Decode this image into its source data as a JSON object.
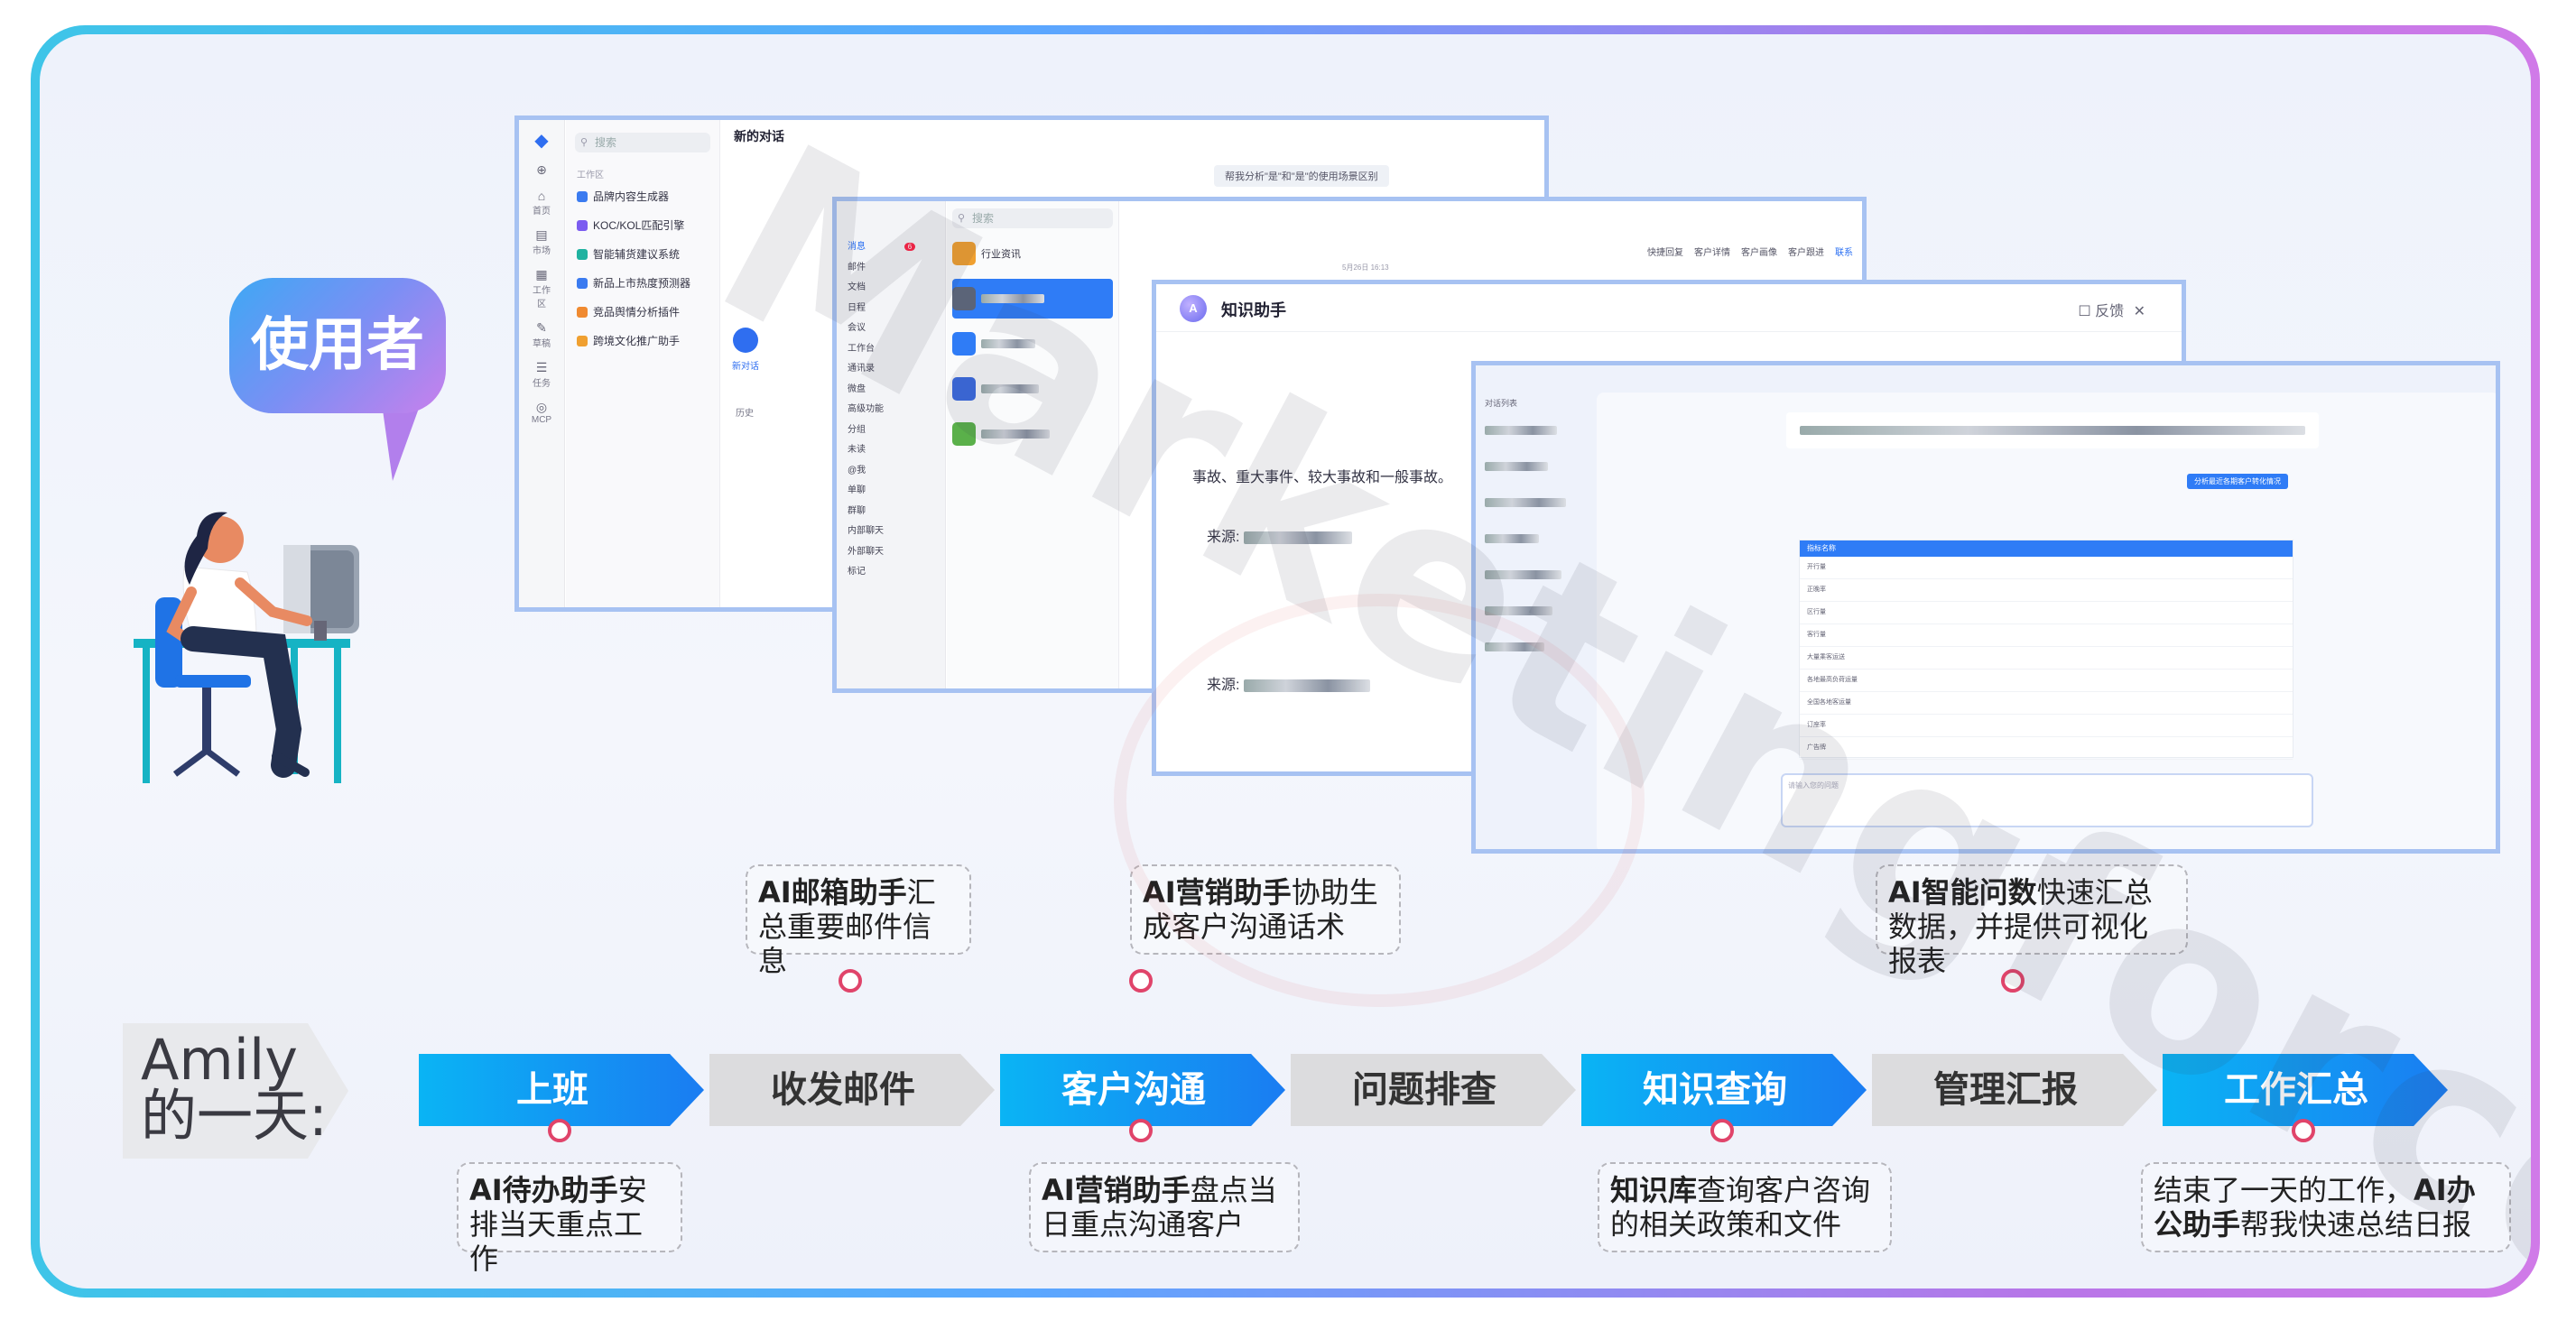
{
  "bubble_label": "使用者",
  "timeline": {
    "title_line1": "Amily",
    "title_line2": "的一天:",
    "steps": [
      {
        "label": "上班",
        "active": true
      },
      {
        "label": "收发邮件",
        "active": false
      },
      {
        "label": "客户沟通",
        "active": true
      },
      {
        "label": "问题排查",
        "active": false
      },
      {
        "label": "知识查询",
        "active": true
      },
      {
        "label": "管理汇报",
        "active": false
      },
      {
        "label": "工作汇总",
        "active": true
      }
    ]
  },
  "notes": {
    "top_mail": {
      "bold": "AI邮箱助手",
      "rest": "汇总重要邮件信息"
    },
    "top_marketing": {
      "bold": "AI营销助手",
      "rest": "协助生成客户沟通话术"
    },
    "top_data": {
      "bold": "AI智能问数",
      "rest": "快速汇总数据，并提供可视化报表"
    },
    "bottom_todo": {
      "bold": "AI待办助手",
      "rest": "安排当天重点工作"
    },
    "bottom_marketing": {
      "bold": "AI营销助手",
      "rest": "盘点当日重点沟通客户"
    },
    "bottom_knowledge": {
      "bold": "知识库",
      "rest": "查询客户咨询的相关政策和文件"
    },
    "bottom_summary": {
      "lead": "结束了一天的工作，",
      "bold": "AI办公助手",
      "rest": "帮我快速总结日报"
    }
  },
  "window1": {
    "search_placeholder": "搜索",
    "title": "新的对话",
    "section": "工作区",
    "items": [
      "品牌内容生成器",
      "KOC/KOL匹配引擎",
      "智能辅货建议系统",
      "新品上市热度预测器",
      "竞品舆情分析插件",
      "跨境文化推广助手"
    ],
    "prompt_pill": "帮我分析\"是\"和\"是\"的使用场景区别",
    "side_labels": [
      "首页",
      "市场",
      "工作区",
      "草稿",
      "任务",
      "MCP"
    ],
    "new_chat": "新对话",
    "history": "历史"
  },
  "window2": {
    "search_placeholder": "搜索",
    "nav": [
      "消息",
      "邮件",
      "文档",
      "日程",
      "会议",
      "工作台",
      "通讯录",
      "微盘",
      "高级功能",
      "分组",
      "未读",
      "@我",
      "单聊",
      "群聊",
      "内部聊天",
      "外部聊天",
      "标记"
    ],
    "unread_badge": "6",
    "industry": "行业资讯",
    "tabs": [
      "快捷回复",
      "客户详情",
      "客户画像",
      "客户跟进",
      "联系"
    ],
    "date": "5月26日 16:13"
  },
  "window3": {
    "title": "知识助手",
    "feedback": "反馈",
    "body_text": "事故、重大事件、较大事故和一般事故。",
    "source_label": "来源:"
  },
  "window4": {
    "sidebar_title": "对话列表",
    "table_header": "指标名称",
    "table_rows": [
      "开行量",
      "正晚率",
      "区行量",
      "客行量",
      "大量乘客运送",
      "各地最高负荷运量",
      "全国各地客运量",
      "订座率",
      "广告牌"
    ],
    "question_chip": "分析最近各期客户转化情况",
    "input_placeholder": "请输入您的问题"
  },
  "colors": {
    "step_active": "#1a7cf2",
    "step_inactive": "#dcdcde",
    "dot": "#e0446a",
    "frame_left": "#3ec5e8",
    "frame_right": "#d07ae8"
  }
}
